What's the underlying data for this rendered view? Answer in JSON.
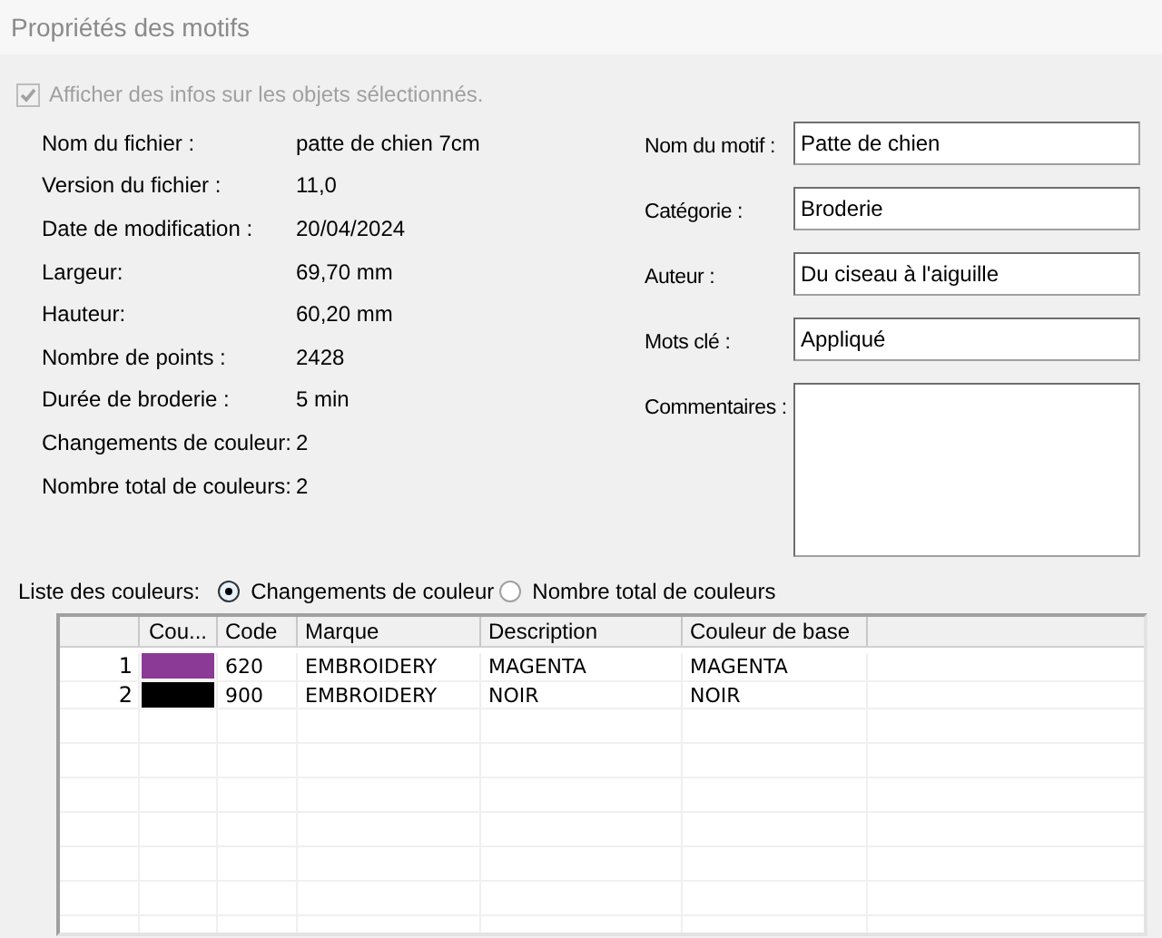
{
  "window": {
    "title": "Propriétés des motifs"
  },
  "show_info": {
    "label": "Afficher des infos sur les objets sélectionnés.",
    "checked": true,
    "disabled": true
  },
  "file_info": [
    {
      "label": "Nom du fichier :",
      "value": "patte de chien 7cm"
    },
    {
      "label": "Version du fichier :",
      "value": "11,0"
    },
    {
      "label": "Date de modification :",
      "value": "20/04/2024"
    },
    {
      "label": "Largeur:",
      "value": "69,70 mm"
    },
    {
      "label": "Hauteur:",
      "value": "60,20 mm"
    },
    {
      "label": "Nombre de points :",
      "value": "2428"
    },
    {
      "label": "Durée de broderie :",
      "value": "5 min"
    },
    {
      "label": "Changements de couleur:",
      "value": "2"
    },
    {
      "label": "Nombre total de couleurs:",
      "value": "2"
    }
  ],
  "motif_fields": [
    {
      "label": "Nom du motif :",
      "value": "Patte de chien",
      "kind": "line"
    },
    {
      "label": "Catégorie :",
      "value": "Broderie",
      "kind": "line"
    },
    {
      "label": "Auteur :",
      "value": "Du ciseau à l'aiguille",
      "kind": "line"
    },
    {
      "label": "Mots clé :",
      "value": "Appliqué",
      "kind": "line"
    },
    {
      "label": "Commentaires :",
      "kind": "multiline"
    }
  ],
  "color_list": {
    "label": "Liste des couleurs:",
    "options": [
      {
        "label": "Changements de couleur",
        "selected": true
      },
      {
        "label": "Nombre total de couleurs",
        "selected": false
      }
    ]
  },
  "table": {
    "columns": [
      "Cou...",
      "Code",
      "Marque",
      "Description",
      "Couleur de base"
    ],
    "rows": [
      {
        "index": "1",
        "color": "#8b3a96",
        "code": "620",
        "brand": "EMBROIDERY",
        "description": "MAGENTA",
        "base_color": "MAGENTA"
      },
      {
        "index": "2",
        "color": "#000000",
        "code": "900",
        "brand": "EMBROIDERY",
        "description": "NOIR",
        "base_color": "NOIR"
      }
    ]
  }
}
